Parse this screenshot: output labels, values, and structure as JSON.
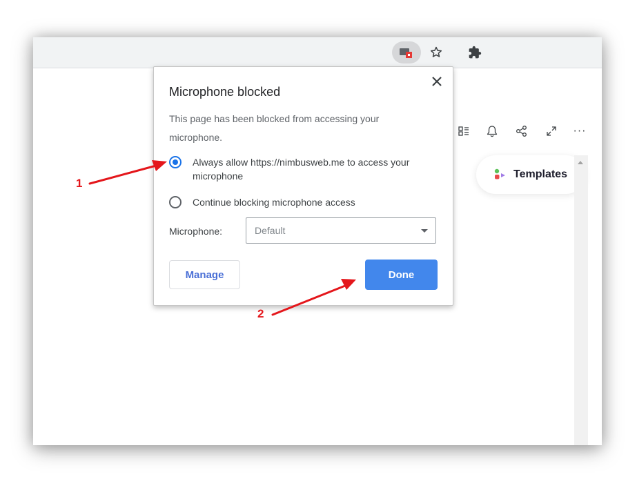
{
  "browser": {
    "toolbar_icons": [
      {
        "name": "camera-blocked-icon",
        "glyph": "camera-blocked"
      },
      {
        "name": "bookmark-star-icon",
        "glyph": "☆"
      },
      {
        "name": "extensions-puzzle-icon",
        "glyph": "puzzle"
      }
    ]
  },
  "page": {
    "toolbar_icons": [
      "list-view-icon",
      "bell-icon",
      "share-icon",
      "expand-icon",
      "more-icon"
    ],
    "more_glyph": "···",
    "templates_label": "Templates"
  },
  "dialog": {
    "title": "Microphone blocked",
    "close_glyph": "✕",
    "description": "This page has been blocked from accessing your microphone.",
    "options": [
      {
        "label": "Always allow https://nimbusweb.me to access your microphone",
        "checked": true
      },
      {
        "label": "Continue blocking microphone access",
        "checked": false
      }
    ],
    "microphone_label": "Microphone:",
    "microphone_value": "Default",
    "manage_label": "Manage",
    "done_label": "Done"
  },
  "annotations": [
    {
      "number": "1",
      "target": "always-allow-radio"
    },
    {
      "number": "2",
      "target": "done-button"
    }
  ],
  "colors": {
    "accent": "#1a73e8",
    "done_button": "#4287ec",
    "annotation": "#e4161b",
    "blocked_badge": "#e53935"
  }
}
